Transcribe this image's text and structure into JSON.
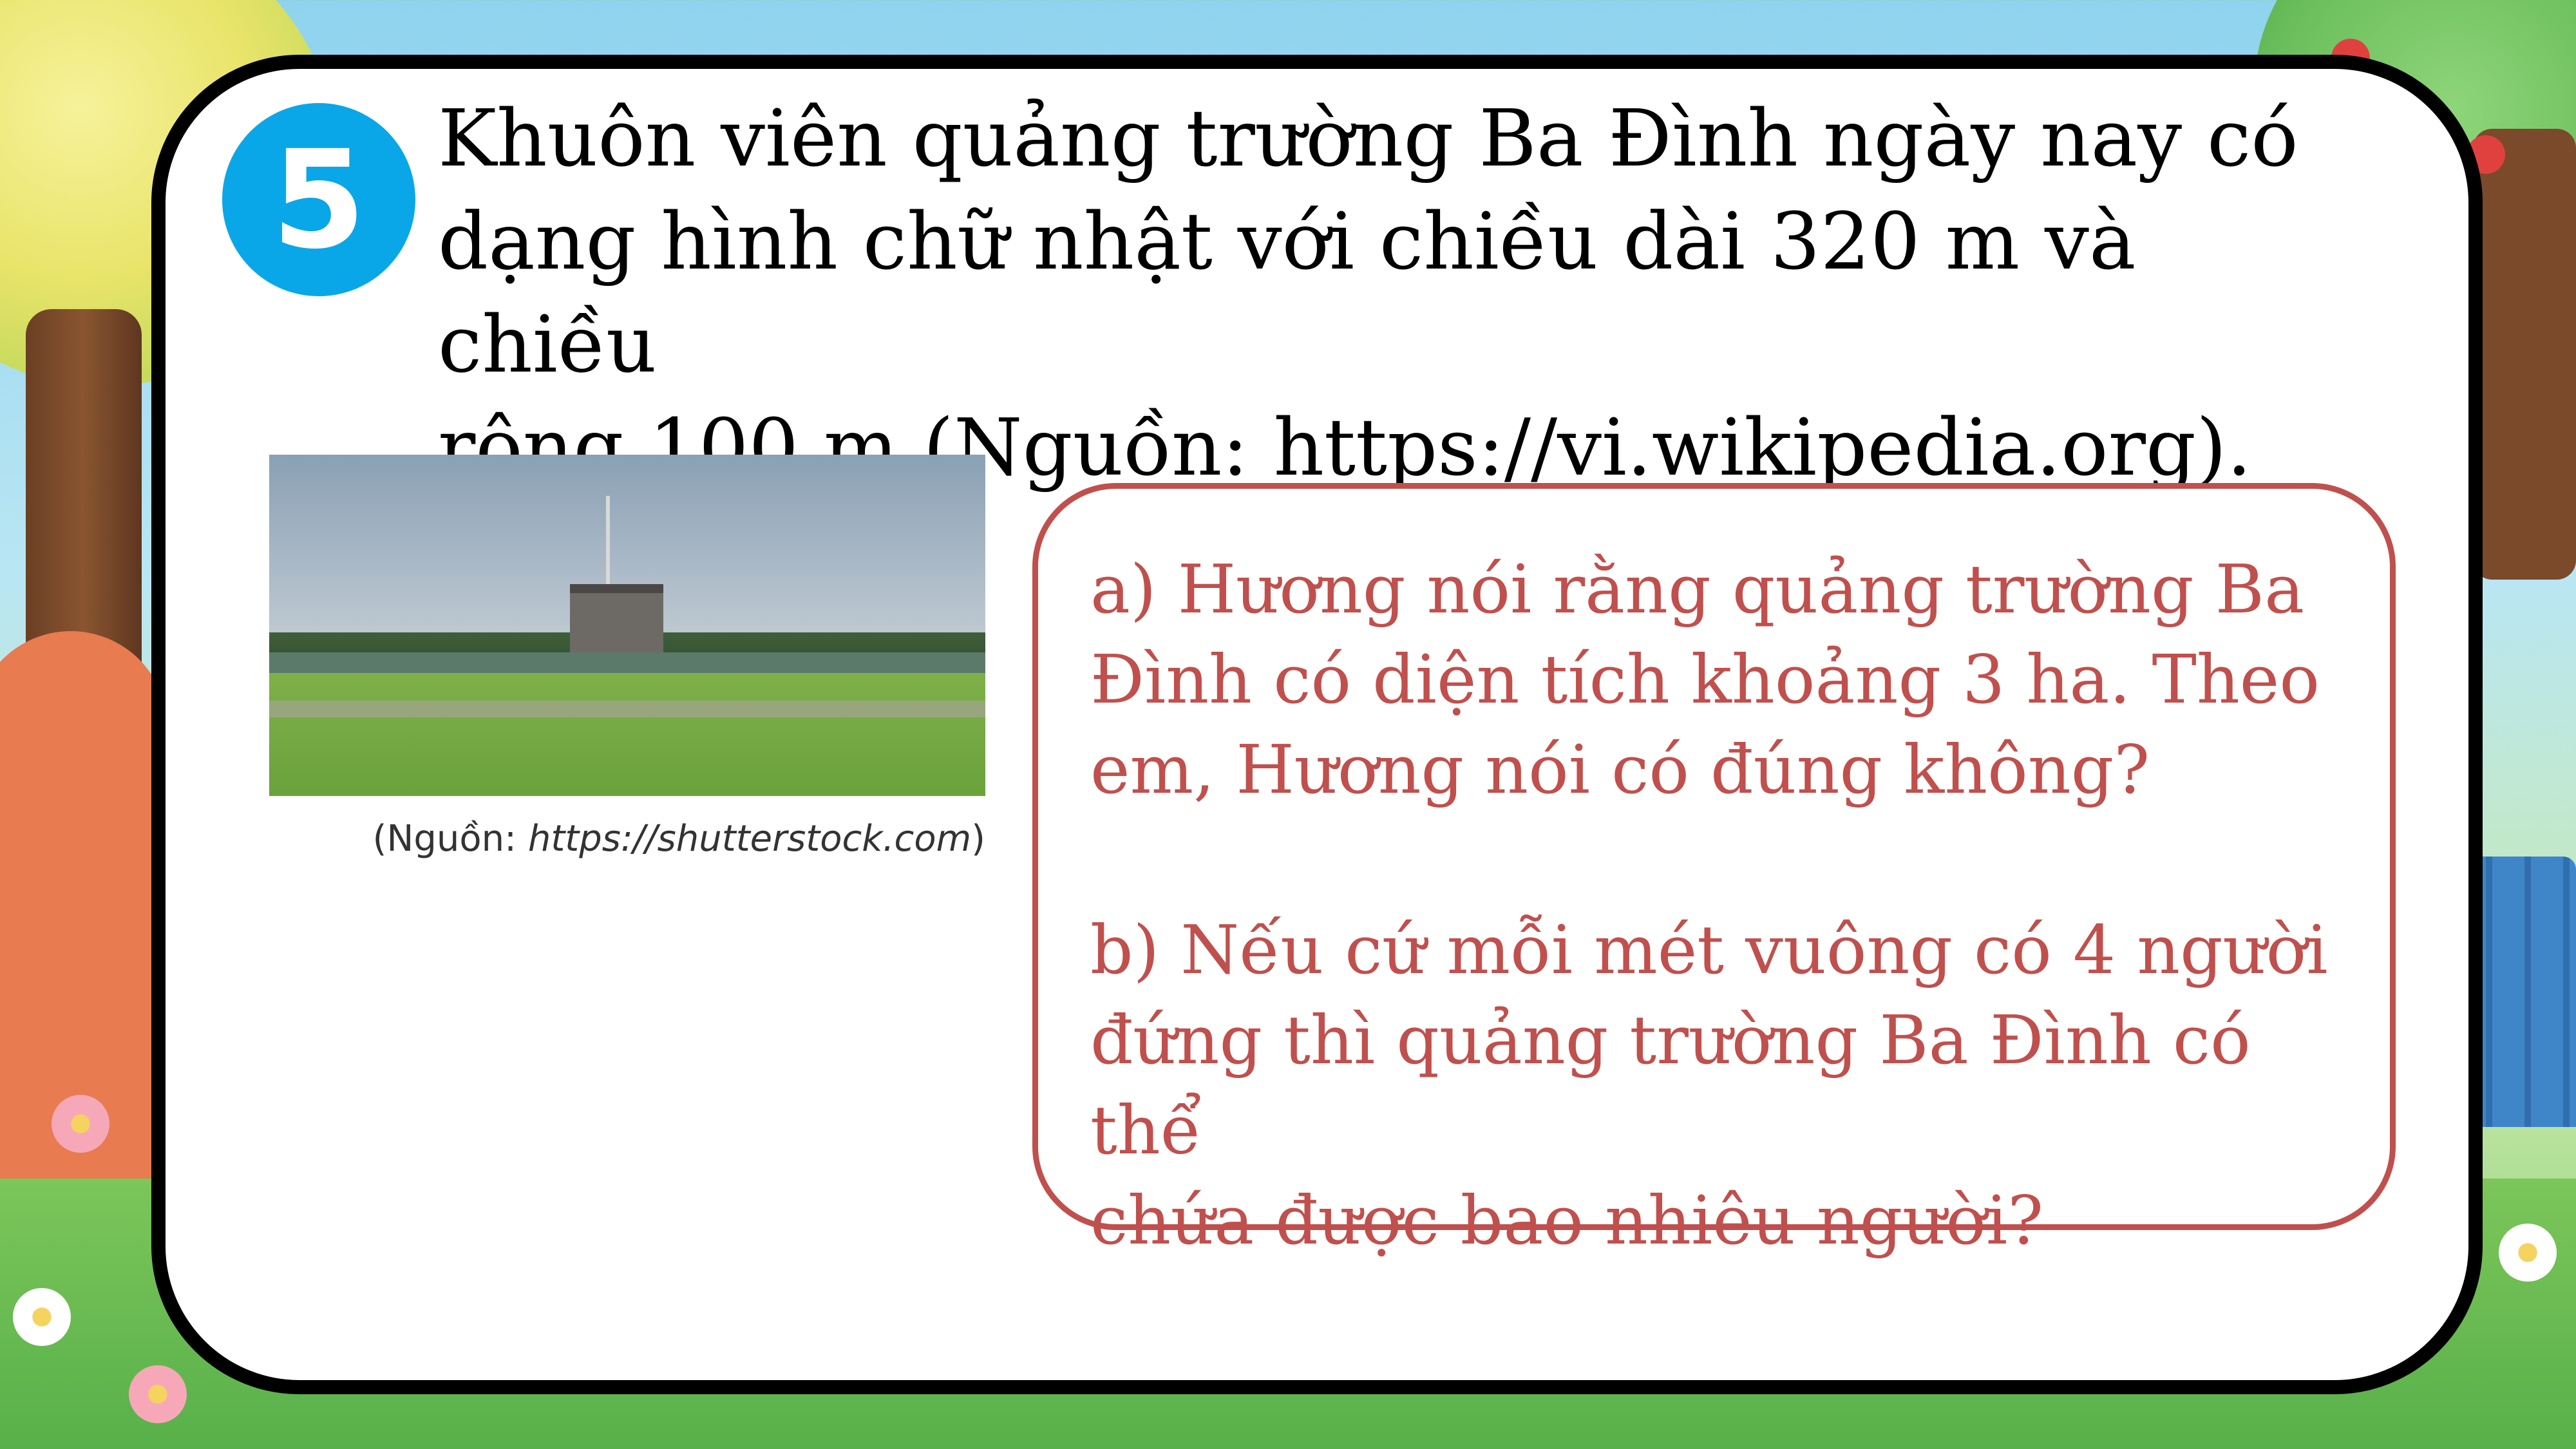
{
  "slide": {
    "number": "5",
    "question_lines": [
      "Khuôn viên quảng trường Ba Đình ngày nay có",
      "dạng hình chữ nhật với chiều dài 320 m và chiều",
      "rộng 100 m (Nguồn: https://vi.wikipedia.org)."
    ],
    "image_caption_prefix": "(Nguồn: ",
    "image_caption_link": "https://shutterstock.com",
    "image_caption_suffix": ")",
    "part_a_lines": [
      "a) Hương nói rằng quảng trường Ba",
      "Đình có diện tích khoảng 3 ha. Theo",
      "em, Hương nói có đúng không?"
    ],
    "part_b_lines": [
      "b) Nếu cứ mỗi mét vuông có 4 người",
      "đứng thì quảng trường Ba Đình có thể",
      "chứa được bao nhiêu người?"
    ]
  },
  "colors": {
    "badge": "#0aa7e8",
    "answer": "#c0504d",
    "card_border": "#000000"
  }
}
